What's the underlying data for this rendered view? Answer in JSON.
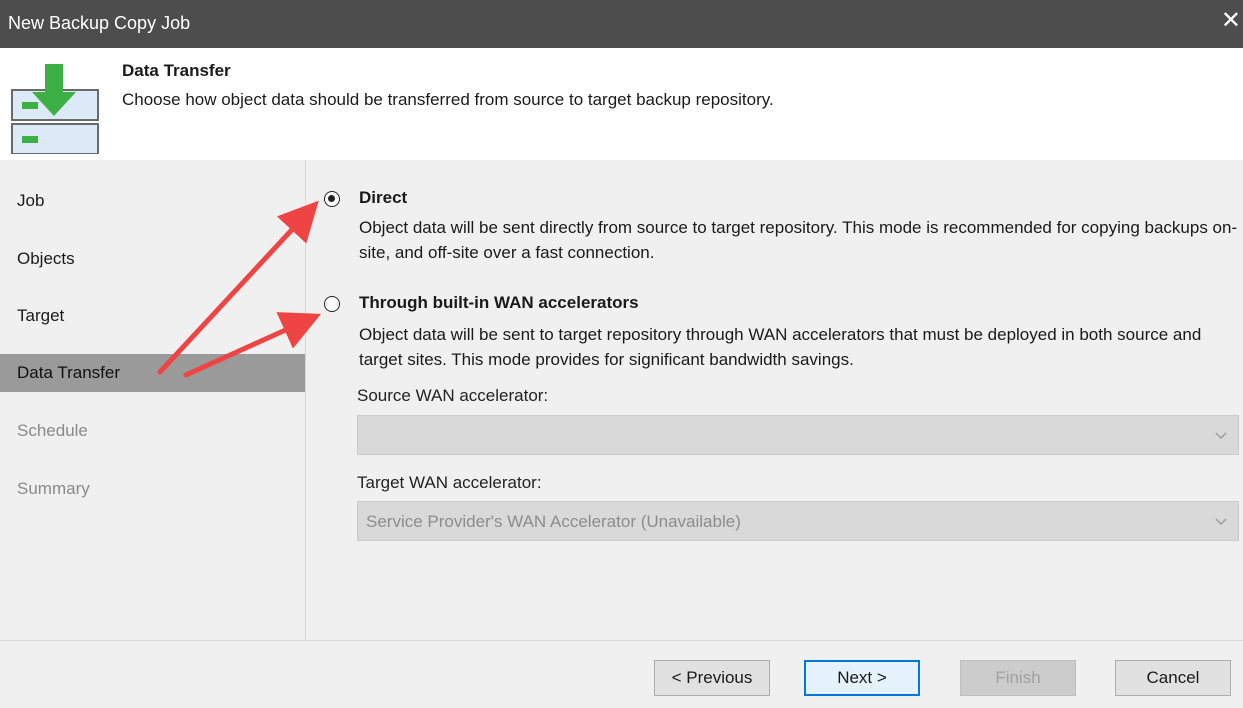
{
  "window": {
    "title": "New Backup Copy Job",
    "close_glyph": "✕"
  },
  "header": {
    "title": "Data Transfer",
    "subtitle": "Choose how object data should be transferred from source to target backup repository.",
    "icon": "download-to-repository-icon"
  },
  "sidebar": {
    "items": [
      {
        "label": "Job",
        "state": "normal"
      },
      {
        "label": "Objects",
        "state": "normal"
      },
      {
        "label": "Target",
        "state": "normal"
      },
      {
        "label": "Data Transfer",
        "state": "active"
      },
      {
        "label": "Schedule",
        "state": "disabled"
      },
      {
        "label": "Summary",
        "state": "disabled"
      }
    ]
  },
  "options": {
    "direct": {
      "label": "Direct",
      "checked": true,
      "description": "Object data will be sent directly from source to target repository. This mode is recommended for copying backups on-site, and off-site over a fast connection."
    },
    "wan": {
      "label": "Through built-in WAN accelerators",
      "checked": false,
      "description": "Object data will be sent to target repository through WAN accelerators that must be deployed in both source and target sites. This mode provides for significant bandwidth savings."
    }
  },
  "fields": {
    "source_wan": {
      "label": "Source WAN accelerator:",
      "value": ""
    },
    "target_wan": {
      "label": "Target WAN accelerator:",
      "value": "Service Provider's WAN Accelerator (Unavailable)"
    }
  },
  "buttons": {
    "previous": "< Previous",
    "next": "Next >",
    "finish": "Finish",
    "cancel": "Cancel"
  },
  "colors": {
    "titlebar": "#4d4d4d",
    "active_nav": "#9a9a9a",
    "annotation_arrow": "#ef4444",
    "primary_button_border": "#0078d7"
  }
}
